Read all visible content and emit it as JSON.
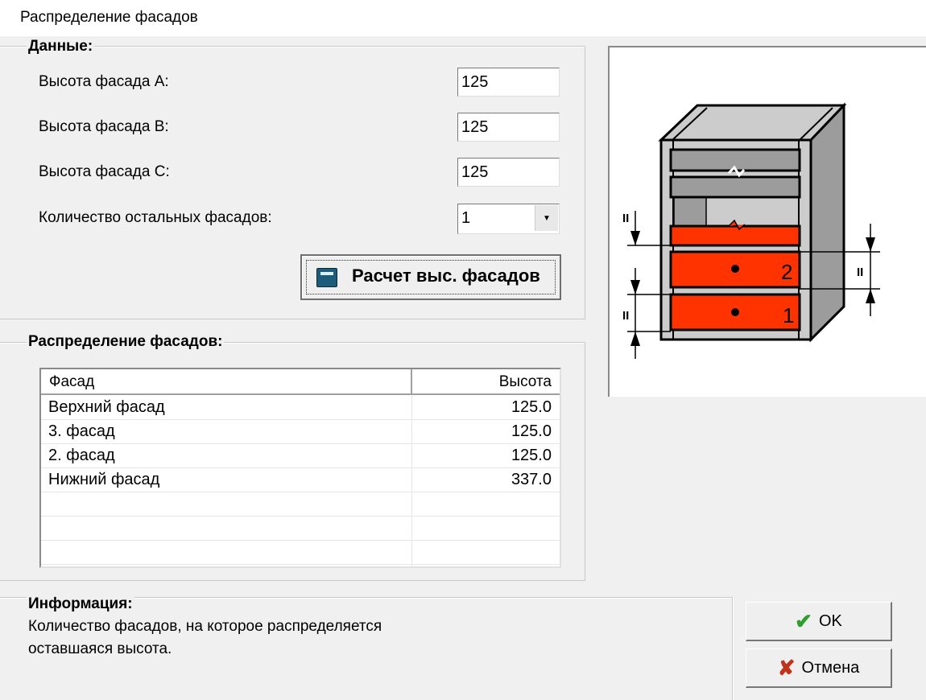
{
  "window": {
    "title": "Распределение фасадов"
  },
  "data_group": {
    "legend": "Данные:",
    "fields": [
      {
        "label": "Высота фасада A:",
        "value": "125"
      },
      {
        "label": "Высота фасада B:",
        "value": "125"
      },
      {
        "label": "Высота фасада C:",
        "value": "125"
      },
      {
        "label": "Количество остальных фасадов:",
        "value": "1"
      }
    ],
    "calc_button": "Расчет выс. фасадов"
  },
  "distribution_group": {
    "legend": "Распределение фасадов:",
    "columns": [
      "Фасад",
      "Высота"
    ],
    "rows": [
      {
        "name": "Верхний фасад",
        "height": "125.0"
      },
      {
        "name": "3. фасад",
        "height": "125.0"
      },
      {
        "name": "2. фасад",
        "height": "125.0"
      },
      {
        "name": "Нижний фасад",
        "height": "337.0"
      }
    ]
  },
  "diagram": {
    "labels": [
      "2",
      "1"
    ],
    "dimension_mark": "II"
  },
  "info": {
    "title": "Информация:",
    "line1": "Количество фасадов, на которое распределяется",
    "line2": "оставшаяся высота."
  },
  "buttons": {
    "ok": "OK",
    "cancel": "Отмена"
  },
  "colors": {
    "drawer": "#ff3300",
    "ok_check": "#2e9e2e",
    "cancel_x": "#c0321a"
  }
}
